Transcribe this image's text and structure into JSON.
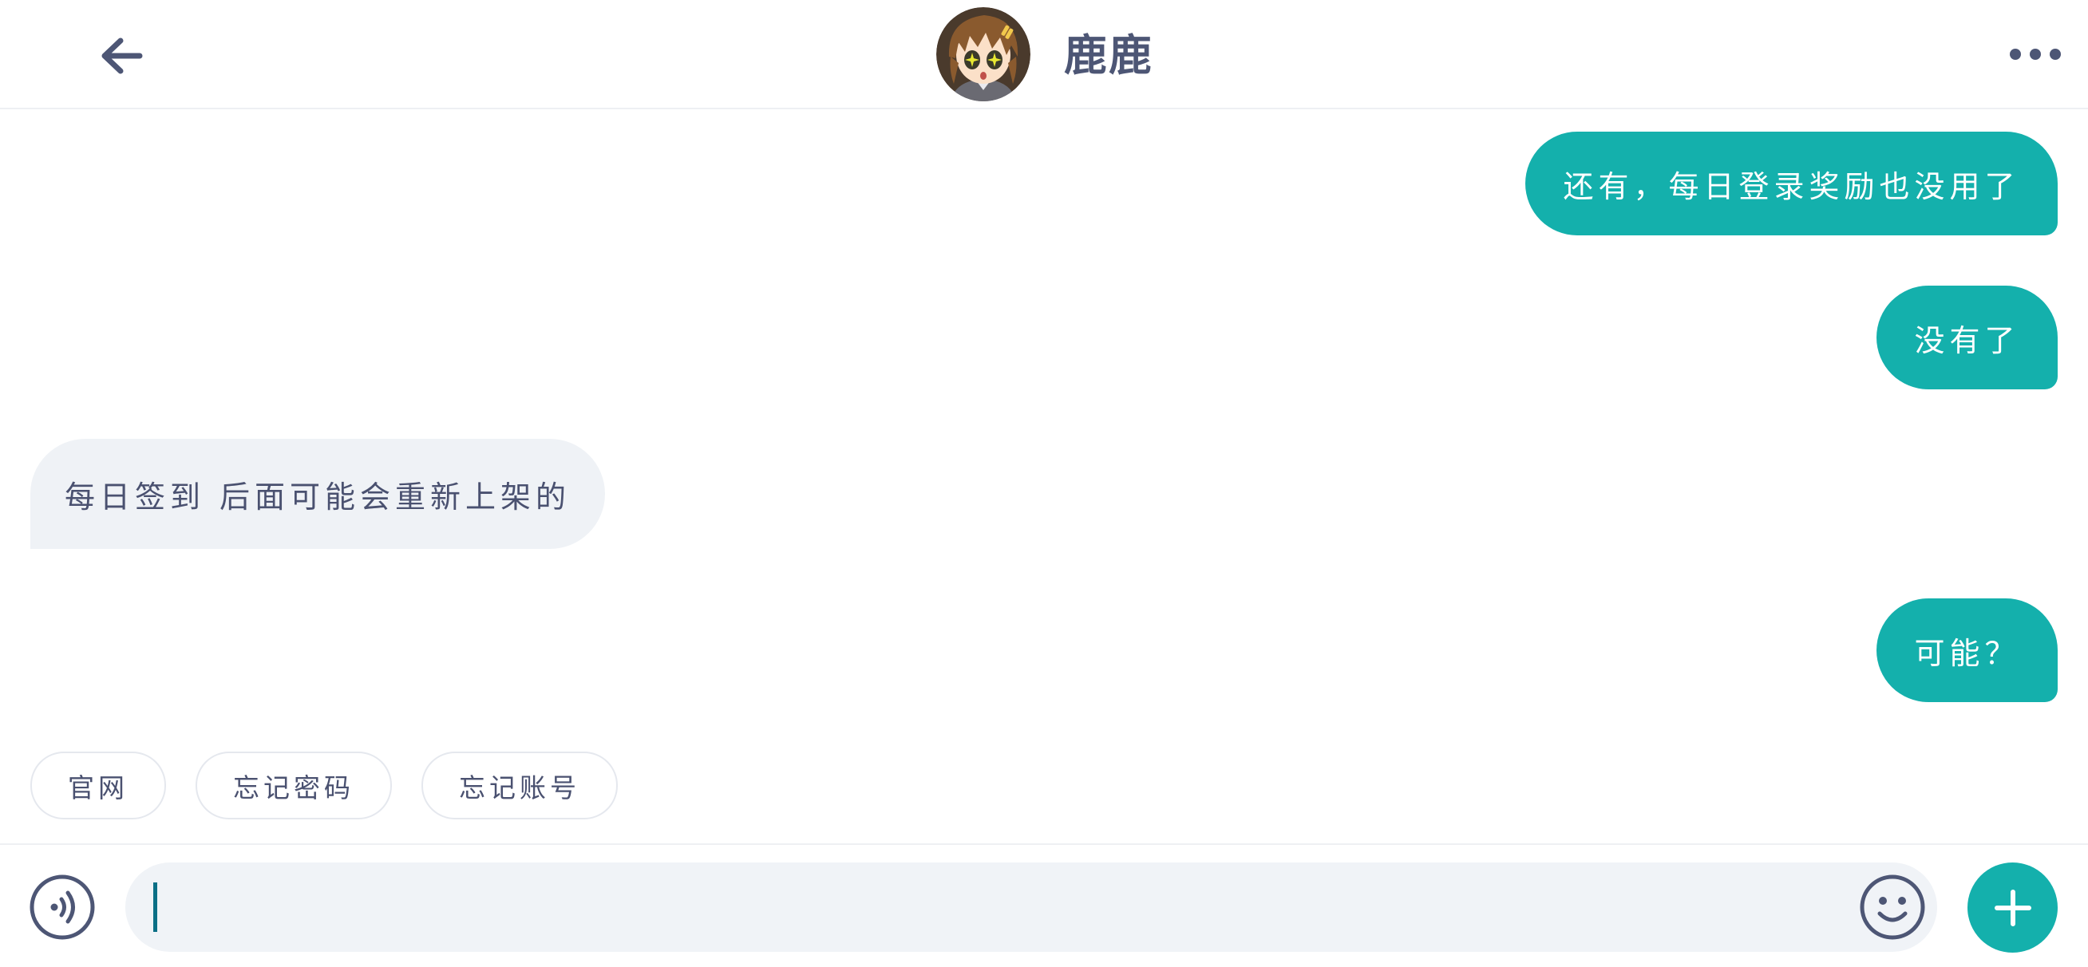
{
  "header": {
    "contact_name": "鹿鹿",
    "back_icon": "arrow-left-icon",
    "more_icon": "more-horizontal-icon",
    "avatar_icon": "anime-girl-avatar"
  },
  "messages": [
    {
      "direction": "outgoing",
      "text": "还有，每日登录奖励也没用了"
    },
    {
      "direction": "outgoing",
      "text": "没有了"
    },
    {
      "direction": "incoming",
      "text": "每日签到 后面可能会重新上架的"
    },
    {
      "direction": "outgoing",
      "text": "可能？"
    }
  ],
  "quick_replies": [
    "官网",
    "忘记密码",
    "忘记账号"
  ],
  "composer": {
    "value": "",
    "placeholder": "",
    "voice_icon": "voice-icon",
    "emoji_icon": "emoji-icon",
    "plus_icon": "plus-icon"
  },
  "colors": {
    "accent": "#14b0ac",
    "incoming_bubble": "#eff2f6",
    "text": "#4a5170",
    "caret": "#0b6f86"
  }
}
